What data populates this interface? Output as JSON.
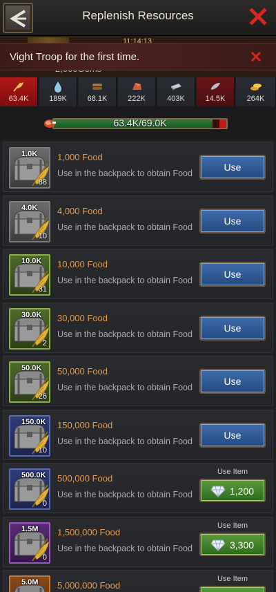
{
  "header": {
    "title": "Replenish Resources"
  },
  "background": {
    "gems_text": "2,000Gems",
    "timer_text": "11:14:13"
  },
  "banner": {
    "text": "Vight Troop for the first time."
  },
  "resource_tabs": [
    {
      "name": "food",
      "value": "63.4K",
      "active": true
    },
    {
      "name": "water",
      "value": "189K"
    },
    {
      "name": "wood",
      "value": "68.1K"
    },
    {
      "name": "ore",
      "value": "222K"
    },
    {
      "name": "steel",
      "value": "403K"
    },
    {
      "name": "oil",
      "value": "14.5K"
    },
    {
      "name": "gold",
      "value": "264K"
    }
  ],
  "progress": {
    "text": "63.4K/69.0K",
    "current": 63.4,
    "max": 69.0
  },
  "items": [
    {
      "badge": "1.0K",
      "name": "1,000 Food",
      "desc": "Use in the backpack to obtain Food",
      "count": "88",
      "rarity": "grey",
      "action": "use",
      "button": "Use"
    },
    {
      "badge": "4.0K",
      "name": "4,000 Food",
      "desc": "Use in the backpack to obtain Food",
      "count": "10",
      "rarity": "grey",
      "action": "use",
      "button": "Use"
    },
    {
      "badge": "10.0K",
      "name": "10,000 Food",
      "desc": "Use in the backpack to obtain Food",
      "count": "31",
      "rarity": "green",
      "action": "use",
      "button": "Use"
    },
    {
      "badge": "30.0K",
      "name": "30,000 Food",
      "desc": "Use in the backpack to obtain Food",
      "count": "2",
      "rarity": "green",
      "action": "use",
      "button": "Use"
    },
    {
      "badge": "50.0K",
      "name": "50,000 Food",
      "desc": "Use in the backpack to obtain Food",
      "count": "26",
      "rarity": "green",
      "action": "use",
      "button": "Use"
    },
    {
      "badge": "150.0K",
      "name": "150,000 Food",
      "desc": "Use in the backpack to obtain Food",
      "count": "10",
      "rarity": "blue",
      "action": "use",
      "button": "Use"
    },
    {
      "badge": "500.0K",
      "name": "500,000 Food",
      "desc": "Use in the backpack to obtain Food",
      "count": "0",
      "rarity": "blue",
      "action": "buy",
      "use_item_label": "Use Item",
      "price": "1,200"
    },
    {
      "badge": "1.5M",
      "name": "1,500,000 Food",
      "desc": "Use in the backpack to obtain Food",
      "count": "0",
      "rarity": "purple",
      "action": "buy",
      "use_item_label": "Use Item",
      "price": "3,300"
    },
    {
      "badge": "5.0M",
      "name": "5,000,000 Food",
      "desc": "Use in the backpack to obtain Food",
      "count": "0",
      "rarity": "orange",
      "action": "buy",
      "use_item_label": "Use Item",
      "price": ""
    }
  ]
}
